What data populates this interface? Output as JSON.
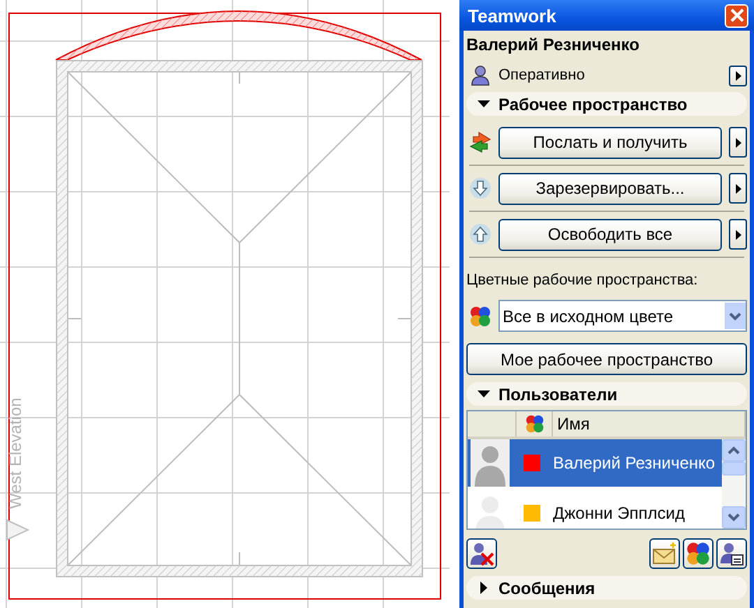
{
  "canvas": {
    "view_label": "West Elevation"
  },
  "window": {
    "title": "Teamwork"
  },
  "user_name": "Валерий Резниченко",
  "status": {
    "label": "Оперативно"
  },
  "workspace": {
    "title": "Рабочее пространство",
    "expanded": true,
    "actions": [
      {
        "kind": "send",
        "label": "Послать и получить"
      },
      {
        "kind": "reserve",
        "label": "Зарезервировать..."
      },
      {
        "kind": "release",
        "label": "Освободить все"
      }
    ],
    "color_label": "Цветные рабочие пространства:",
    "color_mode": "Все в исходном цвете",
    "my_workspace_button": "Мое рабочее пространство"
  },
  "users": {
    "title": "Пользователи",
    "expanded": true,
    "name_column": "Имя",
    "rows": [
      {
        "name": "Валерий Резниченко",
        "color": "#ff0000",
        "selected": true,
        "online": true
      },
      {
        "name": "Джонни Эпплсид",
        "color": "#ffbb00",
        "selected": false,
        "online": false
      }
    ]
  },
  "messages": {
    "title": "Сообщения",
    "expanded": false
  }
}
